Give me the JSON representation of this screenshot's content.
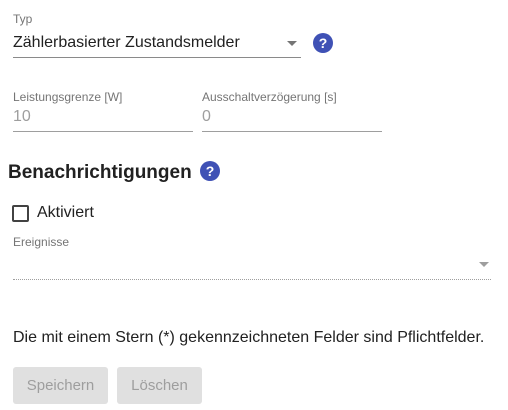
{
  "typ": {
    "label": "Typ",
    "value": "Zählerbasierter Zustandsmelder",
    "help_icon": "help-circle-icon",
    "caret_icon": "dropdown-caret-icon"
  },
  "leistungsgrenze": {
    "label": "Leistungsgrenze [W]",
    "value": "10"
  },
  "ausschaltverzoegerung": {
    "label": "Ausschaltverzögerung [s]",
    "value": "0"
  },
  "notifications": {
    "title": "Benachrichtigungen",
    "help_icon": "help-circle-icon",
    "activated_label": "Aktiviert",
    "activated_checked": false,
    "events_label": "Ereignisse",
    "events_value": ""
  },
  "required_note": "Die mit einem Stern (*) gekennzeichneten Felder sind Pflichtfelder.",
  "buttons": {
    "save": "Speichern",
    "delete": "Löschen"
  },
  "colors": {
    "accent": "#3f51b5",
    "disabled_button_bg": "#e0e0e0",
    "disabled_text": "#9e9e9e"
  }
}
